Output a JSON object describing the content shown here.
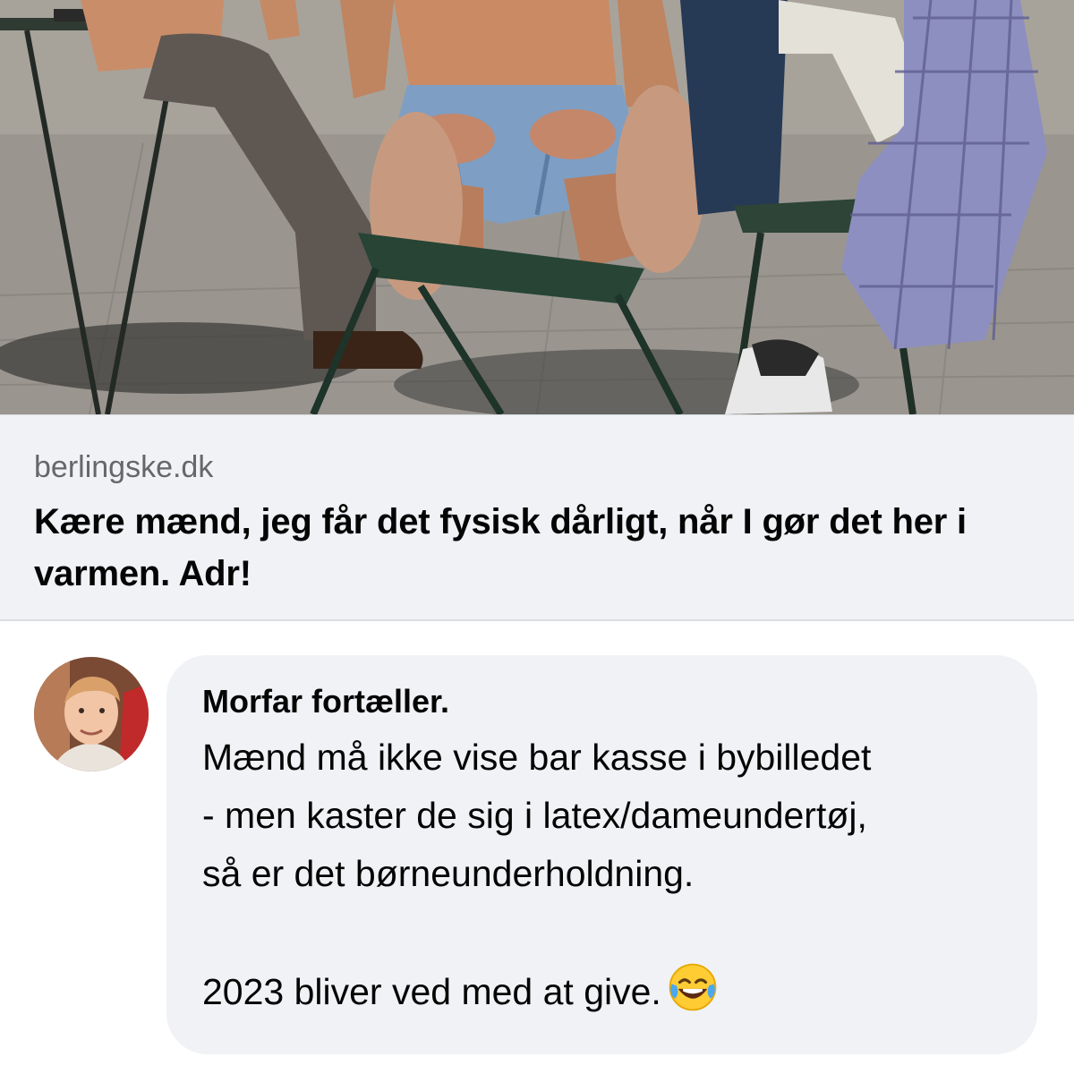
{
  "link_preview": {
    "domain": "berlingske.dk",
    "title": "Kære mænd, jeg får det fysisk dårligt, når I gør det her i varmen. Adr!"
  },
  "comment": {
    "author": "Morfar fortæller.",
    "lines": [
      "Mænd må ikke vise bar kasse i bybilledet",
      "- men kaster de sig i latex/dameundertøj,",
      "så er det børneunderholdning.",
      "2023 bliver ved med at give."
    ],
    "emoji": "face-with-tears-of-joy"
  },
  "colors": {
    "card_background": "#f0f2f5",
    "bubble_background": "#f0f2f5",
    "domain_text": "#65676b",
    "primary_text": "#050505"
  }
}
